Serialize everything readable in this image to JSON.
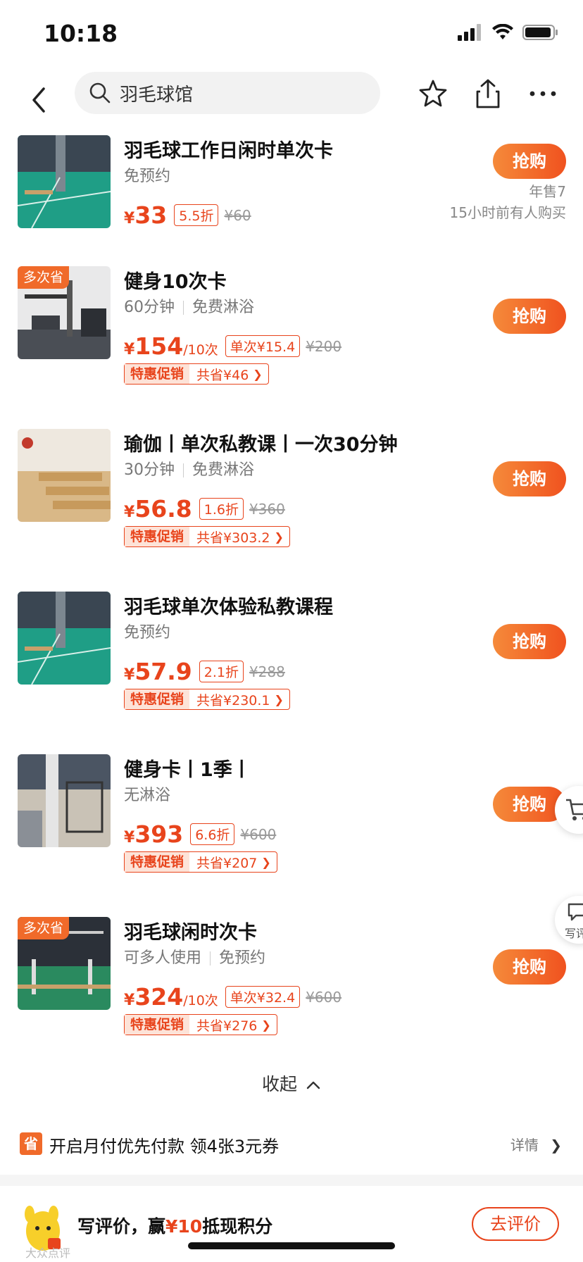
{
  "status_bar": {
    "time": "10:18"
  },
  "nav": {
    "search_text": "羽毛球馆"
  },
  "deals": [
    {
      "title": "羽毛球工作日闲时单次卡",
      "subtitle": [
        "免预约"
      ],
      "price": "33",
      "unit": "",
      "tag": "5.5折",
      "original": "¥60",
      "promo": null,
      "badge": null,
      "meta": [
        "年售7",
        "15小时前有人购买"
      ],
      "buy": "抢购",
      "thumb": "badminton-court"
    },
    {
      "title": "健身10次卡",
      "subtitle": [
        "60分钟",
        "免费淋浴"
      ],
      "price": "154",
      "unit": "/10次",
      "tag": "单次¥15.4",
      "original": "¥200",
      "promo": {
        "label": "特惠促销",
        "text": "共省¥46"
      },
      "badge": "多次省",
      "meta": [],
      "buy": "抢购",
      "thumb": "gym"
    },
    {
      "title": "瑜伽丨单次私教课丨一次30分钟",
      "subtitle": [
        "30分钟",
        "免费淋浴"
      ],
      "price": "56.8",
      "unit": "",
      "tag": "1.6折",
      "original": "¥360",
      "promo": {
        "label": "特惠促销",
        "text": "共省¥303.2"
      },
      "badge": null,
      "meta": [],
      "buy": "抢购",
      "thumb": "yoga-studio"
    },
    {
      "title": "羽毛球单次体验私教课程",
      "subtitle": [
        "免预约"
      ],
      "price": "57.9",
      "unit": "",
      "tag": "2.1折",
      "original": "¥288",
      "promo": {
        "label": "特惠促销",
        "text": "共省¥230.1"
      },
      "badge": null,
      "meta": [],
      "buy": "抢购",
      "thumb": "badminton-court"
    },
    {
      "title": "健身卡丨1季丨",
      "subtitle": [
        "无淋浴"
      ],
      "price": "393",
      "unit": "",
      "tag": "6.6折",
      "original": "¥600",
      "promo": {
        "label": "特惠促销",
        "text": "共省¥207"
      },
      "badge": null,
      "meta": [],
      "buy": "抢购",
      "thumb": "gym-floor"
    },
    {
      "title": "羽毛球闲时次卡",
      "subtitle": [
        "可多人使用",
        "免预约"
      ],
      "price": "324",
      "unit": "/10次",
      "tag": "单次¥32.4",
      "original": "¥600",
      "promo": {
        "label": "特惠促销",
        "text": "共省¥276"
      },
      "badge": "多次省",
      "meta": [],
      "buy": "抢购",
      "thumb": "badminton-hall"
    }
  ],
  "currency": "¥",
  "collapse": {
    "label": "收起"
  },
  "monthly_pay": {
    "icon": "省",
    "text": "开启月付优先付款 领4张3元券",
    "detail": "详情"
  },
  "review": {
    "prefix": "写评价，赢",
    "amount": "¥10",
    "suffix": "抵现积分",
    "button": "去评价",
    "watermark": "大众点评"
  },
  "floating": {
    "review_label": "写评"
  },
  "colors": {
    "accent": "#f0521f",
    "promo_bg": "#fde3d8"
  }
}
